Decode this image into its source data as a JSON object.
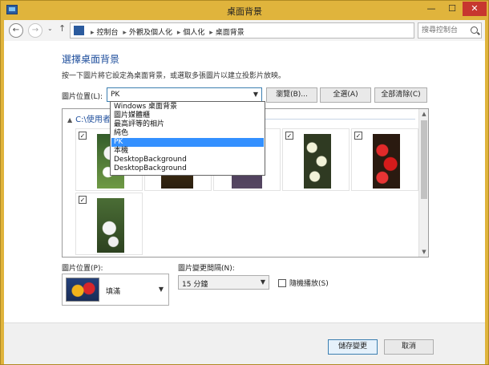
{
  "window": {
    "title": "桌面背景",
    "min_glyph": "—",
    "max_glyph": "☐",
    "close_glyph": "✕"
  },
  "nav": {
    "back_glyph": "←",
    "forward_glyph": "→",
    "history_glyph": "⌄",
    "up_glyph": "↑",
    "dropdown_glyph": "⌄",
    "refresh_glyph": "↻"
  },
  "breadcrumb": {
    "items": [
      "控制台",
      "外觀及個人化",
      "個人化",
      "桌面背景"
    ],
    "sep": "▸"
  },
  "search": {
    "placeholder": "搜尋控制台"
  },
  "page": {
    "heading": "選擇桌面背景",
    "subtitle": "按一下圖片將它設定為桌面背景，或選取多張圖片以建立投影片放映。",
    "picture_location_label": "圖片位置(L):",
    "picture_location_value": "PK",
    "browse_label": "瀏覽(B)...",
    "select_all_label": "全選(A)",
    "clear_all_label": "全部清除(C)"
  },
  "dropdown": {
    "items": [
      "Windows 桌面背景",
      "圖片媒體櫃",
      "最高評等的相片",
      "純色",
      "PK",
      "本機",
      "DesktopBackground",
      "DesktopBackground"
    ],
    "selected_index": 4
  },
  "gallery": {
    "group_header": "C:\\使用者",
    "check_glyph": "✓",
    "tiles": [
      {
        "checked": true
      },
      {
        "checked": true
      },
      {
        "checked": true
      },
      {
        "checked": true
      },
      {
        "checked": true
      },
      {
        "checked": true
      }
    ]
  },
  "bottom": {
    "position_label": "圖片位置(P):",
    "position_value": "填滿",
    "interval_label": "圖片變更間隔(N):",
    "interval_value": "15 分鐘",
    "shuffle_label": "隨機播放(S)",
    "shuffle_checked": false
  },
  "footer": {
    "save_label": "儲存變更",
    "cancel_label": "取消"
  },
  "colors": {
    "accent": "#1e4e9c",
    "selection": "#3390ff",
    "titlebar": "#e0b43c",
    "close": "#c7372f"
  }
}
